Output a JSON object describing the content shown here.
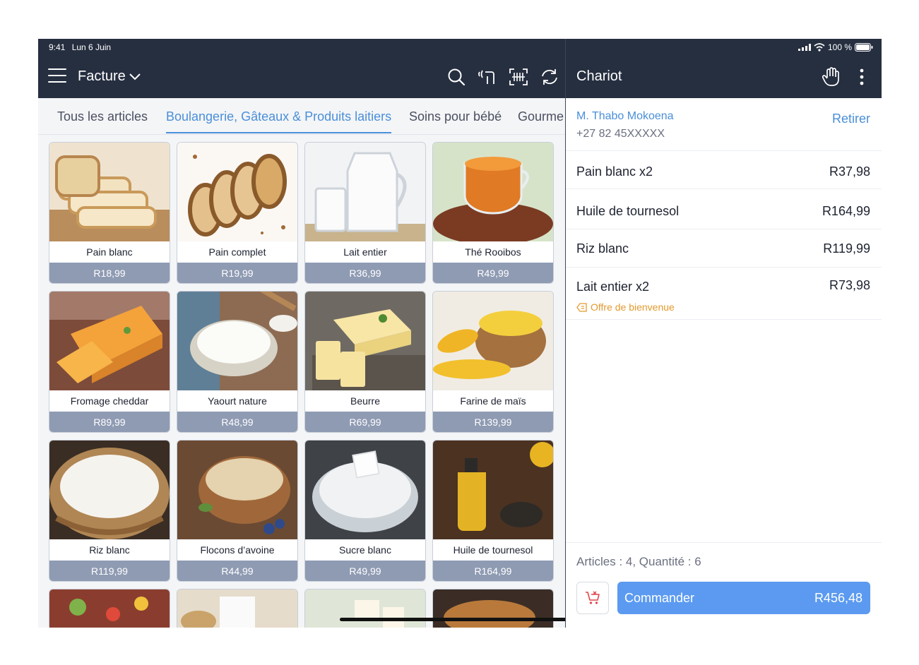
{
  "status": {
    "time": "9:41",
    "date": "Lun 6 Juin",
    "battery": "100 %"
  },
  "header": {
    "title": "Facture",
    "icons": [
      "search-icon",
      "contactless-icon",
      "barcode-scan-icon",
      "refresh-icon"
    ]
  },
  "tabs": [
    {
      "label": "Tous les articles"
    },
    {
      "label": "Boulangerie, Gâteaux & Produits laitiers",
      "active": true
    },
    {
      "label": "Soins pour bébé"
    },
    {
      "label": "Gourme"
    }
  ],
  "products": [
    {
      "name": "Pain blanc",
      "price": "R18,99",
      "image": "bread-image"
    },
    {
      "name": "Pain complet",
      "price": "R19,99",
      "image": "bread-image"
    },
    {
      "name": "Lait entier",
      "price": "R36,99",
      "image": "milk-image"
    },
    {
      "name": "Thé Rooibos",
      "price": "R49,99",
      "image": "tea-image"
    },
    {
      "name": "Fromage cheddar",
      "price": "R89,99",
      "image": "cheese-image"
    },
    {
      "name": "Yaourt nature",
      "price": "R48,99",
      "image": "yogurt-image"
    },
    {
      "name": "Beurre",
      "price": "R69,99",
      "image": "butter-image"
    },
    {
      "name": "Farine de maïs",
      "price": "R139,99",
      "image": "maize-image"
    },
    {
      "name": "Riz blanc",
      "price": "R119,99",
      "image": "rice-image"
    },
    {
      "name": "Flocons d’avoine",
      "price": "R44,99",
      "image": "oats-image"
    },
    {
      "name": "Sucre blanc",
      "price": "R49,99",
      "image": "sugar-image"
    },
    {
      "name": "Huile de tournesol",
      "price": "R164,99",
      "image": "oil-image"
    }
  ],
  "cart": {
    "title": "Chariot",
    "customer": {
      "name": "M. Thabo Mokoena",
      "phone": "+27 82 45XXXXX"
    },
    "remove_label": "Retirer",
    "lines": [
      {
        "name": "Pain blanc x2",
        "price": "R37,98"
      },
      {
        "name": "Huile de tournesol",
        "price": "R164,99"
      },
      {
        "name": "Riz blanc",
        "price": "R119,99"
      },
      {
        "name": "Lait entier x2",
        "price": "R73,98",
        "promo": "Offre de bienvenue"
      }
    ],
    "summary": "Articles : 4, Quantité : 6",
    "order_label": "Commander",
    "order_total": "R456,48"
  },
  "colors": {
    "header": "#262f40",
    "accent": "#4a8fd9",
    "price_bar": "#8f9bb3",
    "order_button": "#5b9af0",
    "promo": "#e39a2d"
  }
}
